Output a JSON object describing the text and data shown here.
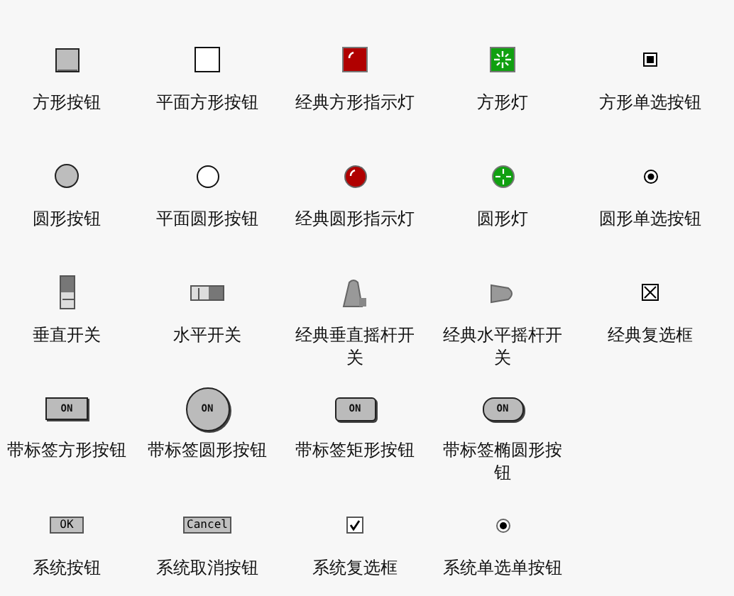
{
  "rows": [
    {
      "items": [
        {
          "kind": "square-button",
          "label": "方形按钮"
        },
        {
          "kind": "flat-square-button",
          "label": "平面方形按钮"
        },
        {
          "kind": "square-indicator",
          "label": "经典方形指示灯",
          "on": true
        },
        {
          "kind": "square-light",
          "label": "方形灯",
          "on": true
        },
        {
          "kind": "square-radio",
          "label": "方形单选按钮",
          "checked": true
        }
      ]
    },
    {
      "items": [
        {
          "kind": "round-button",
          "label": "圆形按钮"
        },
        {
          "kind": "flat-round-button",
          "label": "平面圆形按钮"
        },
        {
          "kind": "round-indicator",
          "label": "经典圆形指示灯",
          "on": true
        },
        {
          "kind": "round-light",
          "label": "圆形灯",
          "on": true
        },
        {
          "kind": "round-radio",
          "label": "圆形单选按钮",
          "checked": true
        }
      ]
    },
    {
      "items": [
        {
          "kind": "vertical-switch",
          "label": "垂直开关",
          "on": false
        },
        {
          "kind": "horizontal-switch",
          "label": "水平开关",
          "on": false
        },
        {
          "kind": "vertical-toggle",
          "label": "经典垂直摇杆开关",
          "on": false
        },
        {
          "kind": "horizontal-toggle",
          "label": "经典水平摇杆开关",
          "on": false
        },
        {
          "kind": "classic-checkbox",
          "label": "经典复选框",
          "checked": true
        }
      ]
    },
    {
      "items": [
        {
          "kind": "labeled-square",
          "label": "带标签方形按钮",
          "text": "ON"
        },
        {
          "kind": "labeled-round",
          "label": "带标签圆形按钮",
          "text": "ON"
        },
        {
          "kind": "labeled-rect",
          "label": "带标签矩形按钮",
          "text": "ON"
        },
        {
          "kind": "labeled-ellipse",
          "label": "带标签椭圆形按钮",
          "text": "ON"
        }
      ]
    },
    {
      "items": [
        {
          "kind": "system-button",
          "label": "系统按钮",
          "text": "OK"
        },
        {
          "kind": "system-button",
          "label": "系统取消按钮",
          "text": "Cancel"
        },
        {
          "kind": "system-checkbox",
          "label": "系统复选框",
          "checked": true
        },
        {
          "kind": "system-radio",
          "label": "系统单选单按钮",
          "checked": true
        }
      ]
    }
  ]
}
